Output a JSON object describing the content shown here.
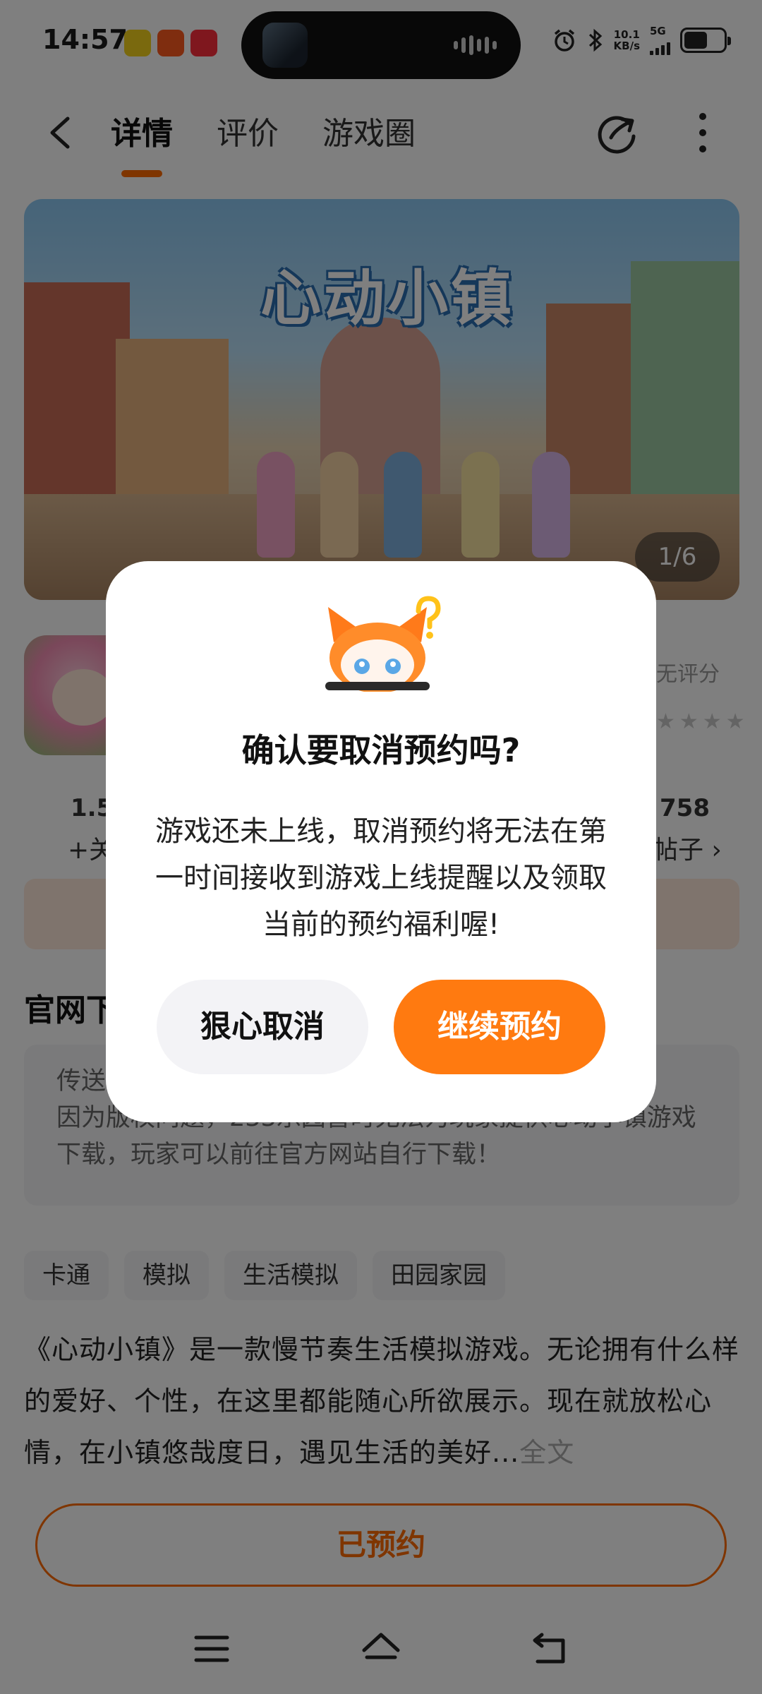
{
  "status_bar": {
    "time": "14:57",
    "net_speed_value": "10.1",
    "net_speed_unit": "KB/s",
    "network": "5G",
    "app_icons": [
      "green-music-app-icon",
      "kuaishou-app-icon",
      "video-app-icon"
    ]
  },
  "header": {
    "tabs": [
      {
        "label": "详情",
        "active": true
      },
      {
        "label": "评价",
        "active": false
      },
      {
        "label": "游戏圈",
        "active": false
      }
    ],
    "accent_color": "#ff6a00"
  },
  "banner": {
    "logo_text": "心动小镇",
    "counter": "1/6"
  },
  "app_info": {
    "score_label": "无评分",
    "stars": "★★★★",
    "stat_left_value": "1.5",
    "stat_left_sub": "+关",
    "stat_right_value": "758",
    "stat_right_sub": "帖子 ›"
  },
  "official": {
    "title": "官网下",
    "notice_line1": "传送",
    "notice_line2": "因为版权问题，233乐园暂时无法为玩家提供心动小镇游戏",
    "notice_line3": "下载，玩家可以前往官方网站自行下载！"
  },
  "tags": [
    "卡通",
    "模拟",
    "生活模拟",
    "田园家园"
  ],
  "description": {
    "text": "《心动小镇》是一款慢节奏生活模拟游戏。无论拥有什么样的爱好、个性，在这里都能随心所欲展示。现在就放松心情，在小镇悠哉度日，遇见生活的美好...",
    "more_label": "全文"
  },
  "reserve_button": {
    "label": "已预约"
  },
  "dialog": {
    "title": "确认要取消预约吗?",
    "body": "游戏还未上线，取消预约将无法在第一时间接收到游戏上线提醒以及领取当前的预约福利喔!",
    "cancel_label": "狠心取消",
    "continue_label": "继续预约",
    "continue_color": "#ff7a10"
  }
}
